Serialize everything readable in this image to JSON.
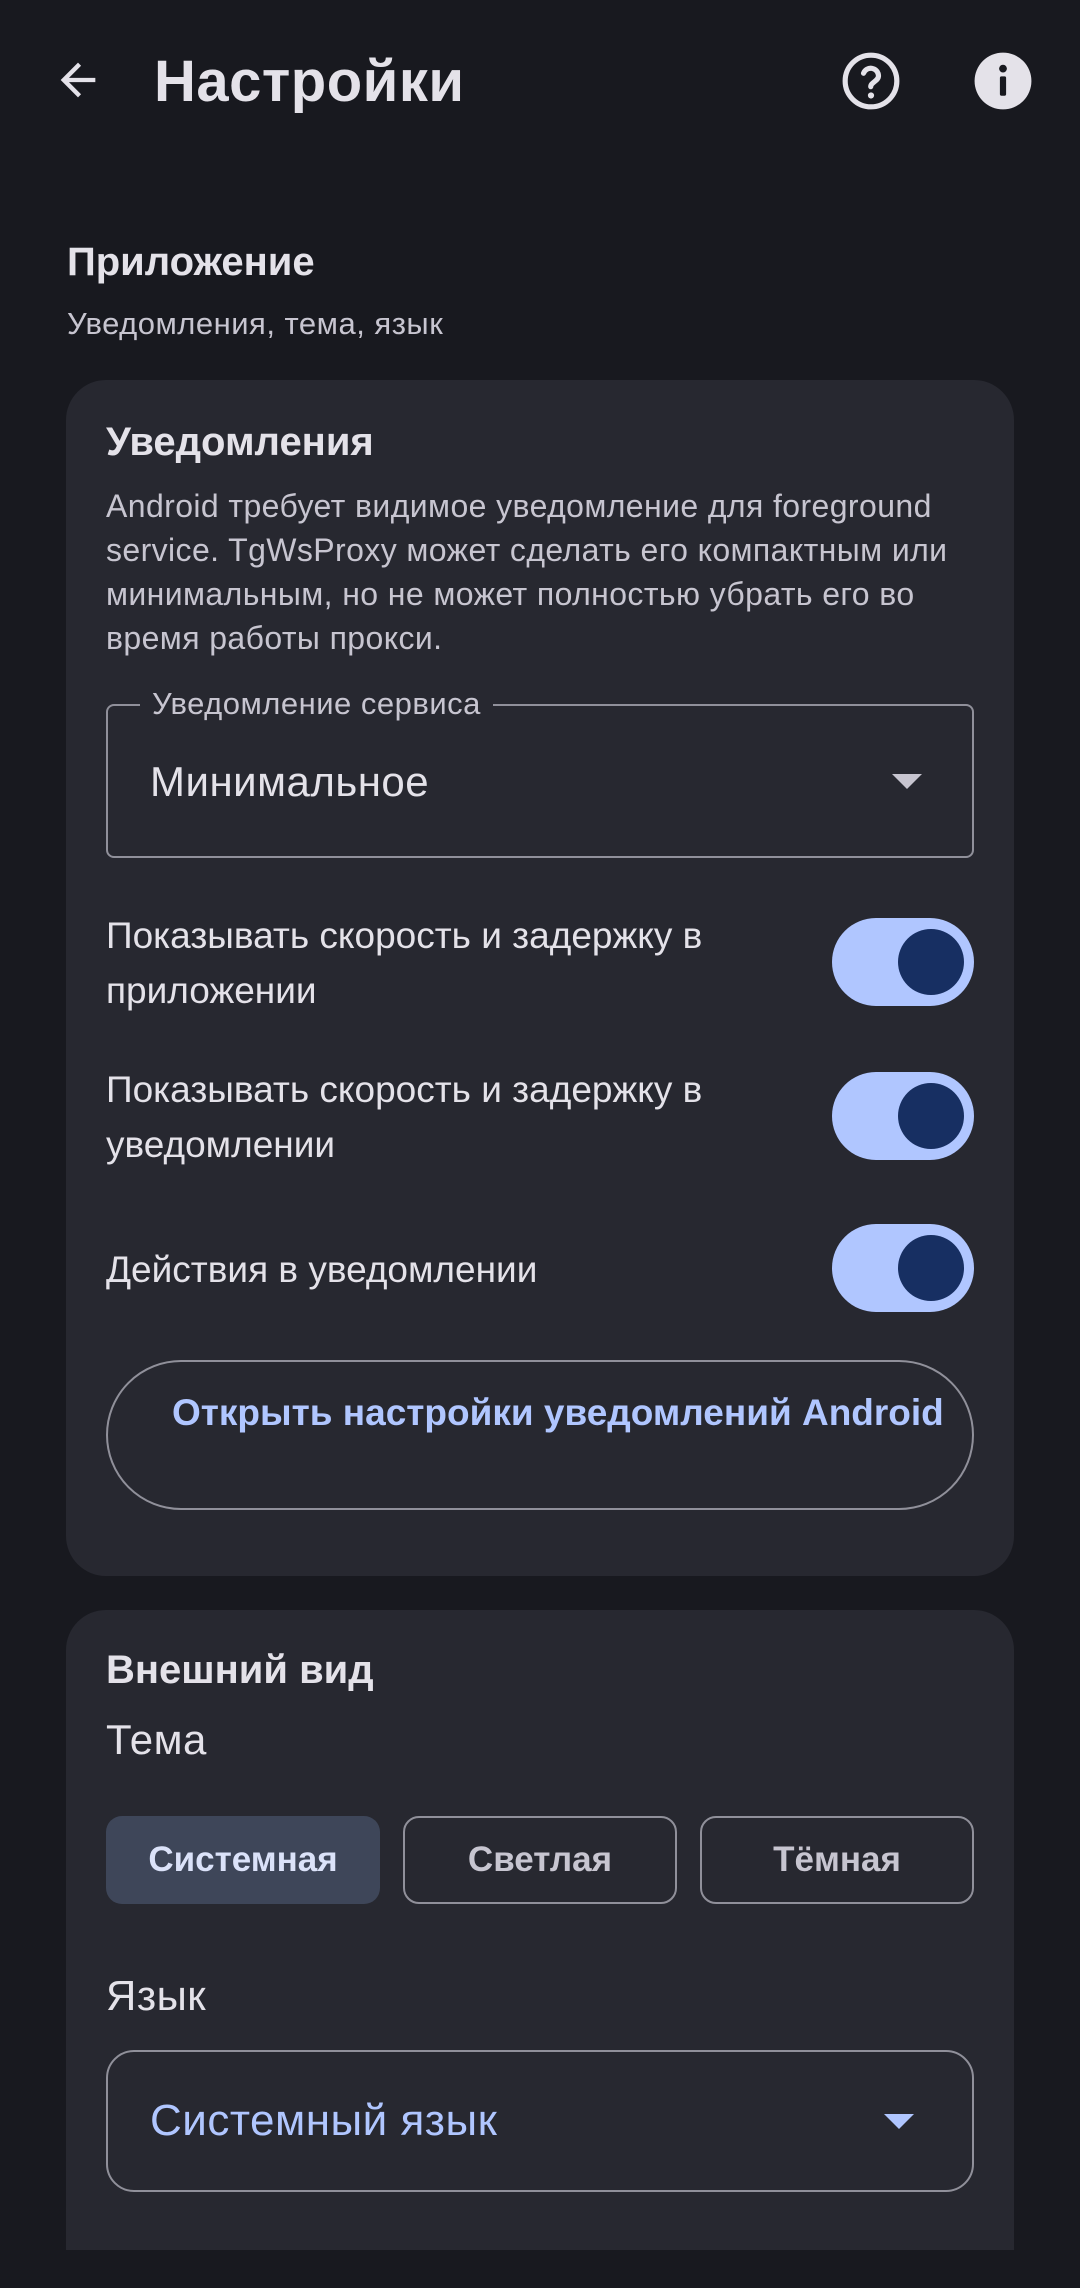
{
  "appbar": {
    "title": "Настройки",
    "back_icon": "arrow-back-icon",
    "help_icon": "help-circle-icon",
    "info_icon": "info-icon"
  },
  "section": {
    "title": "Приложение",
    "subtitle": "Уведомления, тема, язык"
  },
  "notifications": {
    "title": "Уведомления",
    "description": "Android требует видимое уведомление для foreground service. TgWsProxy может сделать его компактным или минимальным, но не может полностью убрать его во время работы прокси.",
    "service_field": {
      "label": "Уведомление сервиса",
      "value": "Минимальное"
    },
    "toggles": [
      {
        "label": "Показывать скорость и задержку в приложении",
        "on": true
      },
      {
        "label": "Показывать скорость и задержку в уведомлении",
        "on": true
      },
      {
        "label": "Действия в уведомлении",
        "on": true
      }
    ],
    "open_settings_button": "Открыть настройки уведомлений Android"
  },
  "appearance": {
    "title": "Внешний вид",
    "theme_label": "Тема",
    "theme_options": [
      "Системная",
      "Светлая",
      "Тёмная"
    ],
    "theme_selected": "Системная",
    "language_label": "Язык",
    "language_value": "Системный язык"
  },
  "colors": {
    "background": "#18191f",
    "card": "#272830",
    "accent": "#b0c6ff",
    "switch_knob": "#172f62",
    "selected_segment": "#3e4659"
  }
}
